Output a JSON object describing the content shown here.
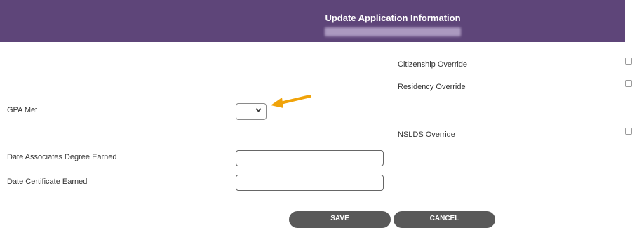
{
  "header": {
    "title": "Update Application Information"
  },
  "overrides": [
    {
      "label": "Citizenship Override"
    },
    {
      "label": "Residency Override"
    },
    {
      "label": "NSLDS Override"
    }
  ],
  "fields": {
    "gpa_met": {
      "label": "GPA Met",
      "value": ""
    },
    "associates_degree": {
      "label": "Date Associates Degree Earned",
      "value": ""
    },
    "certificate": {
      "label": "Date Certificate Earned",
      "value": ""
    }
  },
  "buttons": {
    "save": "SAVE",
    "cancel": "CANCEL"
  },
  "colors": {
    "header_bg": "#5e4579",
    "button_bg": "#595959",
    "arrow": "#f0a30a"
  },
  "icons": {
    "select_chevron": "chevron-down-icon",
    "annotation": "arrow-icon"
  }
}
